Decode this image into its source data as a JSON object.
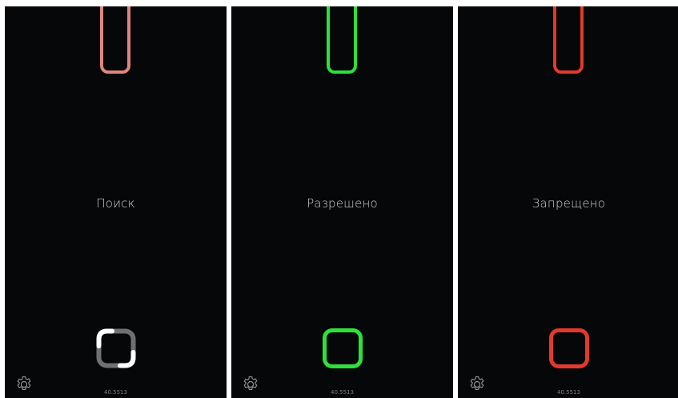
{
  "screens": [
    {
      "status_label": "Поиск",
      "slot_color": "#e0857a",
      "indicator_icon": "searching-spinner-icon",
      "indicator_color": "#6e7072",
      "indicator_accent": "#ffffff",
      "version": "40.5513"
    },
    {
      "status_label": "Разрешено",
      "slot_color": "#2ee03a",
      "indicator_icon": "allowed-square-icon",
      "indicator_color": "#2ee03a",
      "version": "40.5513"
    },
    {
      "status_label": "Запрещено",
      "slot_color": "#e3392b",
      "indicator_icon": "denied-square-icon",
      "indicator_color": "#e3392b",
      "version": "40.5513"
    }
  ],
  "settings_icon": "gear-icon",
  "settings_icon_color": "#8a8d8f"
}
